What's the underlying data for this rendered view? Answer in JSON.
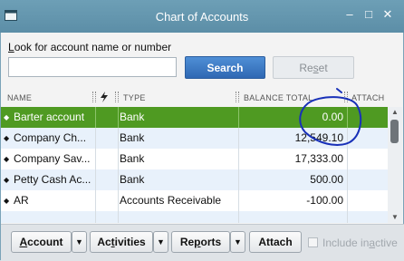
{
  "window": {
    "title": "Chart of Accounts"
  },
  "search": {
    "label_prefix": "",
    "label_hotkey": "L",
    "label_rest": "ook for account name or number",
    "value": "",
    "search_button": "Search",
    "reset_prefix": "Re",
    "reset_hotkey": "s",
    "reset_rest": "et"
  },
  "table": {
    "columns": [
      "NAME",
      "TYPE",
      "BALANCE TOTAL",
      "ATTACH"
    ],
    "rows": [
      {
        "name": "Barter account",
        "type": "Bank",
        "balance": "0.00"
      },
      {
        "name": "Company Ch...",
        "type": "Bank",
        "balance": "12,549.10"
      },
      {
        "name": "Company Sav...",
        "type": "Bank",
        "balance": "17,333.00"
      },
      {
        "name": "Petty Cash Ac...",
        "type": "Bank",
        "balance": "500.00"
      },
      {
        "name": "AR",
        "type": "Accounts Receivable",
        "balance": "-100.00"
      }
    ],
    "selected_row": 0
  },
  "toolbar": {
    "account_hotkey": "A",
    "account_rest": "ccount",
    "activities_prefix": "Ac",
    "activities_hotkey": "t",
    "activities_rest": "ivities",
    "reports_prefix": "Re",
    "reports_hotkey": "p",
    "reports_rest": "orts",
    "attach": "Attach",
    "include_inactive_prefix": "Include in",
    "include_inactive_hotkey": "a",
    "include_inactive_rest": "ctive"
  },
  "colors": {
    "title_bar": "#5c8ea7",
    "selected_row": "#4f9a22",
    "search_button": "#2f68b3",
    "annotation_ink": "#1830b8"
  }
}
